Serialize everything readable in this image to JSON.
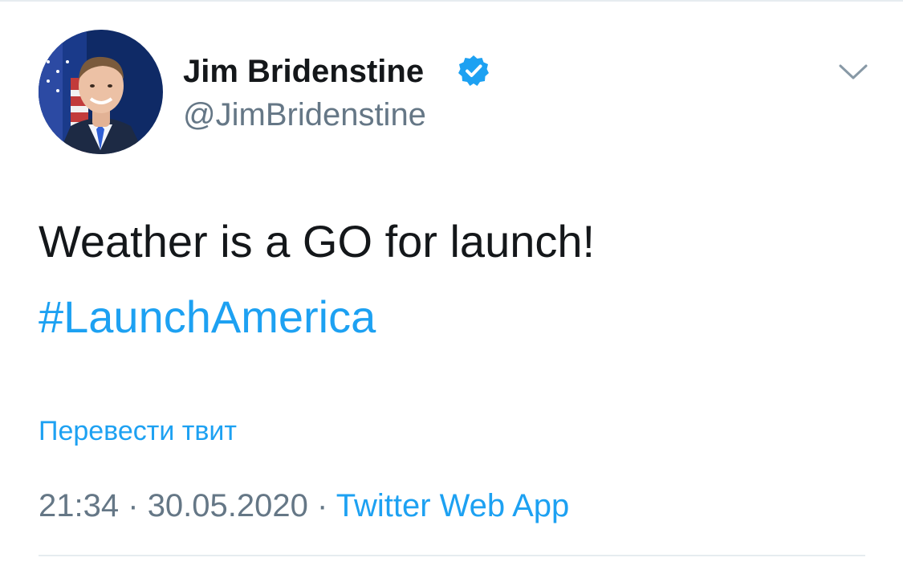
{
  "tweet": {
    "author": {
      "display_name": "Jim Bridenstine",
      "handle": "@JimBridenstine",
      "verified": true,
      "avatar_icon": "profile-photo"
    },
    "text": "Weather is a GO for launch!",
    "hashtag": "#LaunchAmerica",
    "translate_label": "Перевести твит",
    "time": "21:34",
    "separator": "·",
    "date": "30.05.2020",
    "source": "Twitter Web App",
    "menu_icon": "chevron-down-icon"
  },
  "colors": {
    "text_primary": "#14171a",
    "text_secondary": "#657786",
    "accent": "#1da1f2",
    "divider": "#e6ecf0"
  }
}
